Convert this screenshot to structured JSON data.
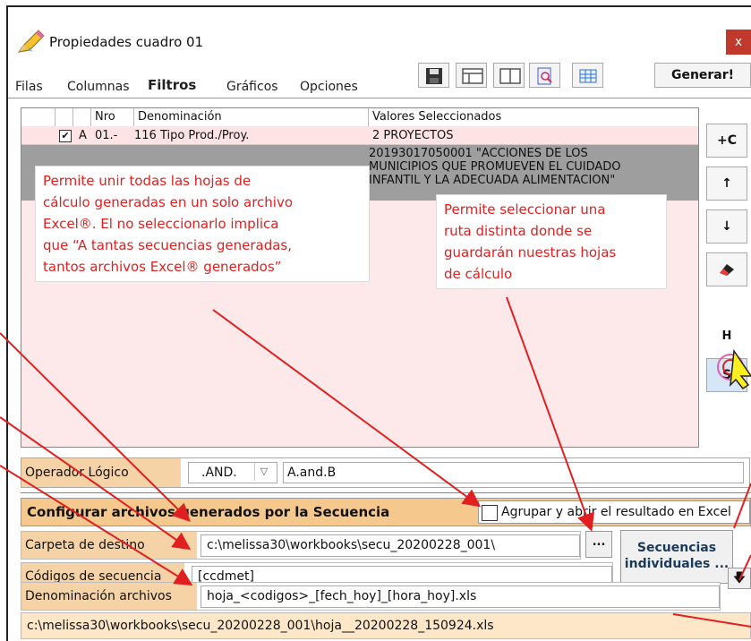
{
  "window": {
    "title": "Propiedades cuadro 01",
    "close": "x"
  },
  "tabs": [
    {
      "label": "Filas"
    },
    {
      "label": "Columnas"
    },
    {
      "label": "Filtros"
    },
    {
      "label": "Gráficos"
    },
    {
      "label": "Opciones"
    }
  ],
  "toolbar": {
    "generate_label": "Generar!"
  },
  "grid": {
    "headers": [
      "Nro",
      "Denominación",
      "Valores Seleccionados"
    ],
    "rows": [
      {
        "flag": "A",
        "nro": "01.-",
        "denom": "116 Tipo Prod./Proy.",
        "valor": "2 PROYECTOS",
        "checked": "✔"
      },
      {
        "valor_line1": "20193017050001 \"ACCIONES DE LOS",
        "valor_line2": "MUNICIPIOS QUE PROMUEVEN EL CUIDADO",
        "valor_line3": "INFANTIL Y LA ADECUADA ALIMENTACION\""
      }
    ]
  },
  "side_buttons": {
    "add": "+C",
    "up": "↑",
    "down": "↓",
    "erase": "eraser",
    "h": "H",
    "s": "S"
  },
  "callouts": {
    "left": "Permite unir todas las hojas de cálculo generadas en un solo archivo Excel®. El no seleccionarlo implica que “A tantas secuencias generadas, tantos archivos Excel® generados”",
    "left_lines": [
      "Permite unir todas las hojas de",
      "cálculo generadas en un solo archivo",
      "Excel®. El no seleccionarlo implica",
      "que “A tantas secuencias generadas,",
      "tantos archivos Excel® generados”"
    ],
    "right_lines": [
      "Permite seleccionar una",
      "ruta distinta donde se",
      "guardarán nuestras hojas",
      "de cálculo"
    ]
  },
  "operator": {
    "label": "Operador Lógico",
    "value": ".AND.",
    "expression": "A.and.B"
  },
  "config": {
    "title": "Configurar archivos generados por la Secuencia",
    "group_label": "Agrupar y abrir el resultado en Excel"
  },
  "fields": {
    "folder_label": "Carpeta de destino",
    "folder_value": "c:\\melissa30\\workbooks\\secu_20200228_001\\",
    "codes_label": "Códigos de secuencia",
    "codes_value": "[ccdmet]",
    "names_label": "Denominación archivos",
    "names_value": "hoja_<codigos>_[fech_hoy]_[hora_hoy].xls",
    "browse": "...",
    "individual_line1": "Secuencias",
    "individual_line2": "individuales ..."
  },
  "result_path": "c:\\melissa30\\workbooks\\secu_20200228_001\\hoja__20200228_150924.xls",
  "colors": {
    "arrow": "#e02020",
    "header_orange": "#f5c88d",
    "label_orange": "#f5d3a6",
    "panel_pink": "#fde9e9"
  }
}
